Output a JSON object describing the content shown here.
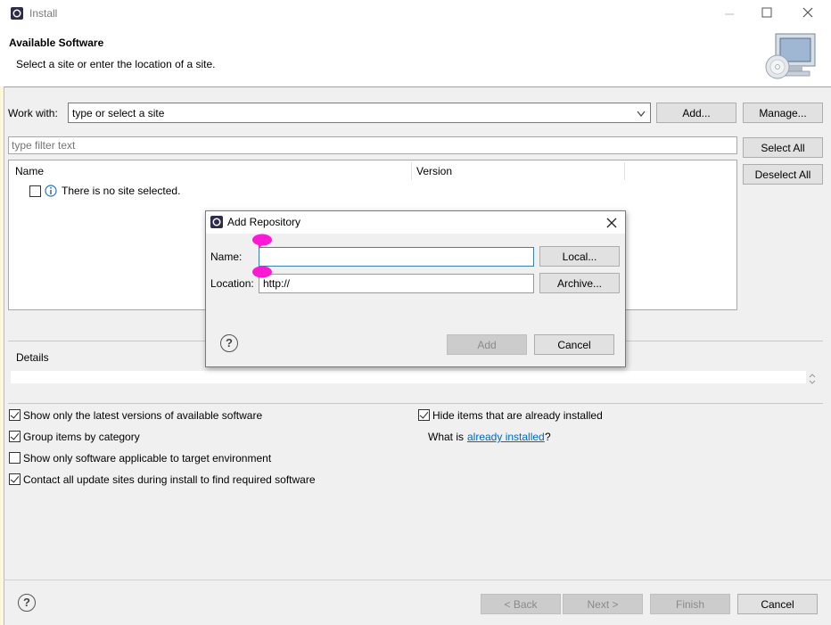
{
  "window": {
    "title": "Install",
    "header_title": "Available Software",
    "header_subtitle": "Select a site or enter the location of a site."
  },
  "work_with": {
    "label": "Work with:",
    "value": "type or select a site",
    "add_label": "Add...",
    "manage_label": "Manage..."
  },
  "filter": {
    "placeholder": "type filter text",
    "select_all_label": "Select All",
    "deselect_all_label": "Deselect All"
  },
  "table": {
    "columns": [
      "Name",
      "Version"
    ],
    "rows": [
      {
        "name": "There is no site selected."
      }
    ]
  },
  "details": {
    "label": "Details"
  },
  "options": {
    "latest_versions": {
      "label": "Show only the latest versions of available software",
      "checked": true
    },
    "group_by_category": {
      "label": "Group items by category",
      "checked": true
    },
    "target_env": {
      "label": "Show only software applicable to target environment",
      "checked": false
    },
    "contact_sites": {
      "label": "Contact all update sites during install to find required software",
      "checked": true
    },
    "hide_installed": {
      "label": "Hide items that are already installed",
      "checked": true
    },
    "what_is_prefix": "What is",
    "already_installed_link": "already installed",
    "what_is_suffix": "?"
  },
  "footer": {
    "back_label": "< Back",
    "next_label": "Next >",
    "finish_label": "Finish",
    "cancel_label": "Cancel",
    "help_glyph": "?"
  },
  "dialog": {
    "title": "Add Repository",
    "name_label": "Name:",
    "name_value": "",
    "location_label": "Location:",
    "location_value": "http://",
    "local_label": "Local...",
    "archive_label": "Archive...",
    "add_label": "Add",
    "cancel_label": "Cancel",
    "help_glyph": "?"
  },
  "colors": {
    "link": "#0066cc",
    "focus_border": "#3c7fb1",
    "info_icon": "#2b73c9",
    "marker": "#ff19d4"
  }
}
